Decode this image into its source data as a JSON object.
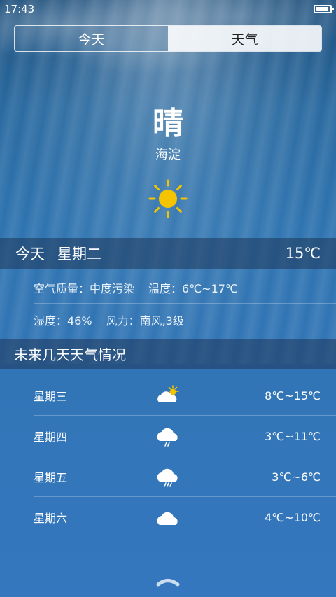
{
  "status_bar": {
    "time": "17:43",
    "battery_level": 0.9
  },
  "tabs": [
    {
      "label": "今天",
      "active": false
    },
    {
      "label": "天气",
      "active": true
    }
  ],
  "current": {
    "condition": "晴",
    "district": "海淀",
    "icon": "sun-icon"
  },
  "today": {
    "label": "今天",
    "weekday": "星期二",
    "temperature": "15℃",
    "air_quality": "空气质量：中度污染",
    "temp_range": "温度：6℃~17℃",
    "humidity": "湿度：46%",
    "wind": "风力：南风,3级"
  },
  "forecast": {
    "title": "未来几天天气情况",
    "days": [
      {
        "day": "星期三",
        "icon": "partly-cloudy-icon",
        "temp": "8℃~15℃"
      },
      {
        "day": "星期四",
        "icon": "rain-cloud-icon",
        "temp": "3℃~11℃"
      },
      {
        "day": "星期五",
        "icon": "rain-cloud-icon",
        "temp": "3℃~6℃"
      },
      {
        "day": "星期六",
        "icon": "cloud-icon",
        "temp": "4℃~10℃"
      }
    ]
  },
  "colors": {
    "sun": "#f5c400",
    "active_tab_bg": "#e8eef4",
    "band_bg": "#243b5c"
  }
}
